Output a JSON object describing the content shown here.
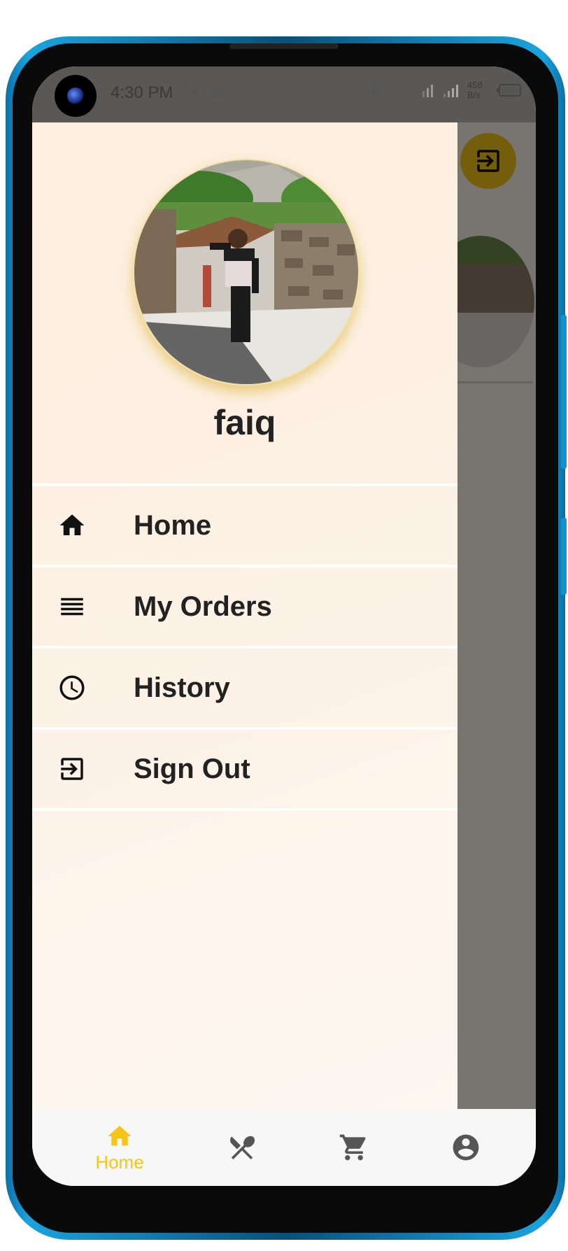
{
  "status_bar": {
    "time": "4:30 PM",
    "net_speed_value": "458",
    "net_speed_unit": "B/s",
    "icons": [
      "upload-icon",
      "cloud-icon",
      "mute-icon",
      "wifi-icon",
      "signal-icon",
      "signal-icon",
      "battery-icon"
    ]
  },
  "drawer": {
    "user_name": "faiq",
    "items": [
      {
        "label": "Home",
        "icon": "home-icon"
      },
      {
        "label": "My Orders",
        "icon": "list-icon"
      },
      {
        "label": "History",
        "icon": "clock-icon"
      },
      {
        "label": "Sign Out",
        "icon": "sign-out-icon"
      }
    ]
  },
  "bottom_nav": {
    "items": [
      {
        "label": "Home",
        "icon": "home-icon",
        "active": true
      },
      {
        "label": "",
        "icon": "cutlery-icon",
        "active": false
      },
      {
        "label": "",
        "icon": "cart-icon",
        "active": false
      },
      {
        "label": "",
        "icon": "account-icon",
        "active": false
      }
    ]
  },
  "colors": {
    "accent": "#f5c518",
    "drawer_bg": "#fdeedd",
    "text": "#222222"
  }
}
